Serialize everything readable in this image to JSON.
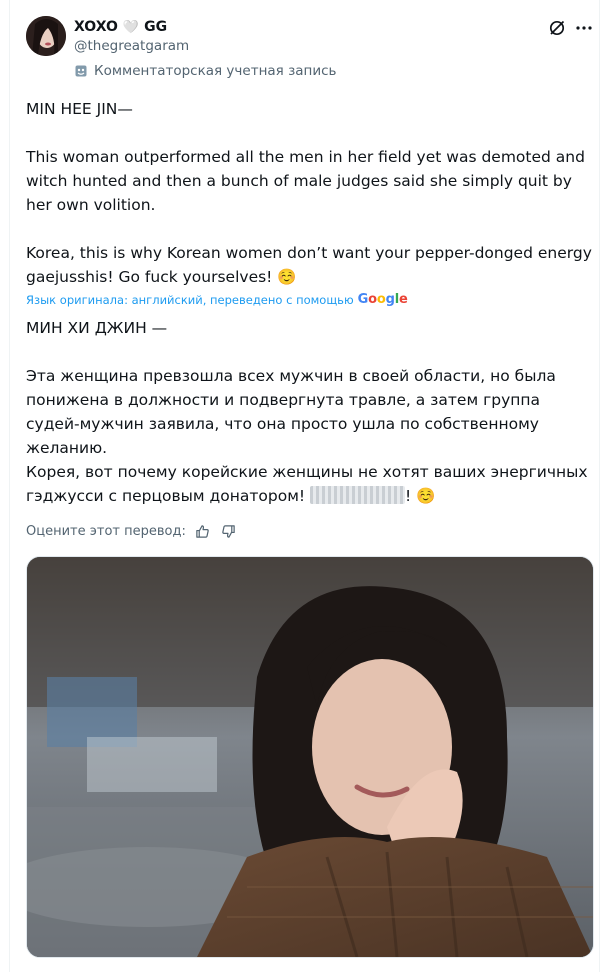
{
  "author": {
    "display_name": "XOXO",
    "heart": "🤍",
    "display_suffix": "GG",
    "handle": "@thegreatgaram",
    "account_label": "Комментаторская учетная запись",
    "avatar_icon": "avatar"
  },
  "original": {
    "line1": "MIN HEE JIN—",
    "para2": "This woman outperformed all the men in her field yet was demoted and witch hunted and then a bunch of male judges said she simply quit by her own volition.",
    "para3": "Korea, this is why Korean women don’t want your pepper-donged energy gaejusshis! Go fuck yourselves! ☺️"
  },
  "translation_note": {
    "text": "Язык оригинала: английский, переведено с помощью",
    "brand": "Google"
  },
  "translated": {
    "line1": "МИН ХИ ДЖИН —",
    "para2": "Эта женщина превзошла всех мужчин в своей области, но была понижена в должности и подвергнута травле, а затем группа судей-мужчин заявила, что она просто ушла по собственному желанию.",
    "para3_start": "Корея, вот почему корейские женщины не хотят ваших энергичных гэджусси с перцовым донатором!",
    "para3_end": "! ☺️"
  },
  "rate": {
    "label": "Оцените этот перевод:"
  },
  "colors": {
    "link": "#1d9bf0",
    "secondary": "#536471"
  }
}
